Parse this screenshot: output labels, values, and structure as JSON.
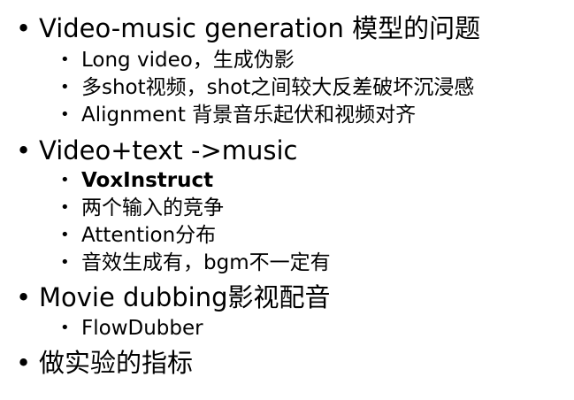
{
  "bullets": {
    "level1": "•",
    "level2": "•"
  },
  "items": [
    {
      "text": "Video-music generation 模型的问题",
      "children": [
        "Long video，生成伪影",
        "多shot视频，shot之间较大反差破坏沉浸感",
        "Alignment 背景音乐起伏和视频对齐"
      ]
    },
    {
      "text": "Video+text ->music",
      "children": [
        "VoxInstruct",
        "两个输入的竞争",
        "Attention分布",
        "音效生成有，bgm不一定有"
      ]
    },
    {
      "text": "Movie dubbing影视配音",
      "children": [
        "FlowDubber"
      ]
    },
    {
      "text": "做实验的指标",
      "children": []
    }
  ]
}
